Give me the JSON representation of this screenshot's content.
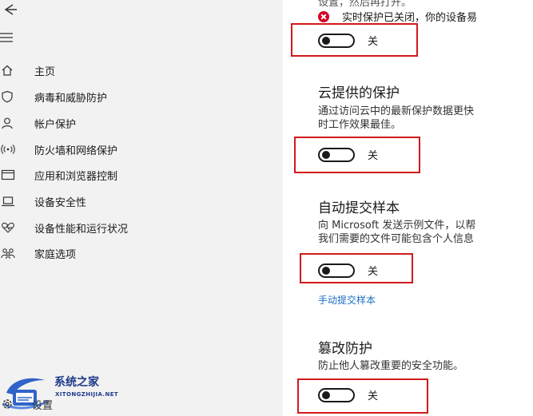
{
  "sidebar": {
    "items": [
      {
        "icon": "home-icon",
        "label": "主页"
      },
      {
        "icon": "shield-icon",
        "label": "病毒和威胁防护"
      },
      {
        "icon": "person-icon",
        "label": "帐户保护"
      },
      {
        "icon": "wifi-signal-icon",
        "label": "防火墙和网络保护"
      },
      {
        "icon": "browser-window-icon",
        "label": "应用和浏览器控制"
      },
      {
        "icon": "laptop-icon",
        "label": "设备安全性"
      },
      {
        "icon": "heart-icon",
        "label": "设备性能和运行状况"
      },
      {
        "icon": "family-icon",
        "label": "家庭选项"
      }
    ],
    "settings_partial": "设置"
  },
  "watermark": {
    "title": "系统之家",
    "subtitle": "XITONGZHIJIA.NET"
  },
  "main": {
    "cut_text": "设置，然后再打开。",
    "alert_text": "实时保护已关闭，你的设备易",
    "realtime_toggle_label": "关",
    "cloud": {
      "title": "云提供的保护",
      "desc_line1": "通过访问云中的最新保护数据更快",
      "desc_line2": "时工作效果最佳。",
      "toggle_label": "关"
    },
    "sample": {
      "title": "自动提交样本",
      "desc_line1": "向 Microsoft 发送示例文件，以帮",
      "desc_line2": "我们需要的文件可能包含个人信息",
      "toggle_label": "关",
      "link": "手动提交样本"
    },
    "tamper": {
      "title": "篡改防护",
      "desc": "防止他人篡改重要的安全功能。",
      "toggle_label": "关"
    }
  },
  "colors": {
    "highlight_box": "#d11a1a",
    "link": "#1a6fc4",
    "alert": "#d70022",
    "sidebar_bg": "#f2f2f2"
  }
}
